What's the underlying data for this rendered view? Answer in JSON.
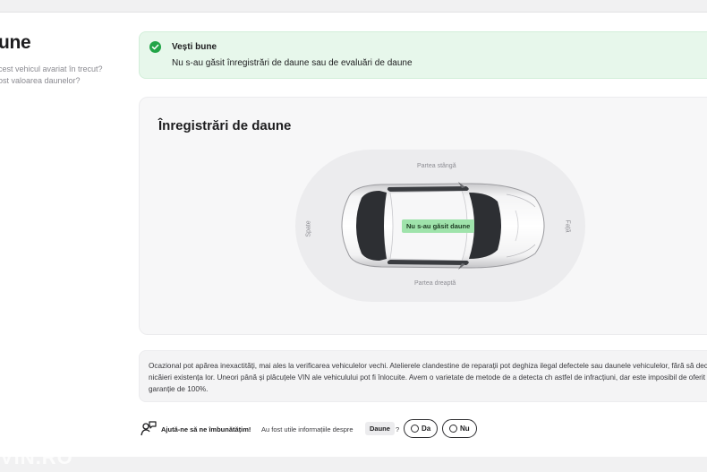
{
  "page": {
    "title": "une",
    "questions": [
      "cest vehicul avariat în trecut?",
      "ost valoarea daunelor?"
    ]
  },
  "good_news": {
    "title": "Vești bune",
    "message": "Nu s-au găsit înregistrări de daune sau de evaluări de daune",
    "icon": "check-circle-icon",
    "color": "#21a447"
  },
  "damage_records": {
    "heading": "Înregistrări de daune",
    "labels": {
      "left": "Partea stângă",
      "right": "Partea dreaptă",
      "rear": "Spate",
      "front": "Față"
    },
    "badge": "Nu s-au găsit daune",
    "badge_color": "#9fe3ab"
  },
  "disclaimer": {
    "text": "Ocazional pot apărea inexactități, mai ales la verificarea vehiculelor vechi. Atelierele clandestine de reparații pot deghiza ilegal defectele sau daunele vehiculelor, fără să declare nicăieri existența lor. Uneori până și plăcuțele VIN ale vehiculului pot fi înlocuite. Avem o varietate de metode de a detecta ch astfel de infracțiuni, dar este imposibil de oferit o garanție de 100%."
  },
  "feedback": {
    "prompt": "Ajută-ne să ne îmbunătățim!",
    "question": "Au fost utile informațiile despre",
    "topic": "Daune",
    "question_mark": "?",
    "yes_label": "Da",
    "no_label": "Nu",
    "icon": "feedback-chat-icon"
  },
  "watermark": "VIN.RO"
}
